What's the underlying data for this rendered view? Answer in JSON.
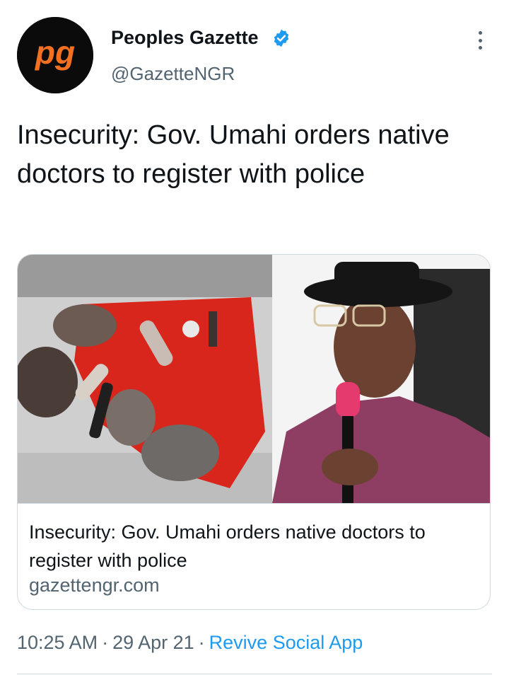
{
  "author": {
    "display_name": "Peoples Gazette",
    "handle": "@GazetteNGR",
    "avatar_logo_text": "pg",
    "verified_icon": "verified-badge-icon",
    "verified_color": "#1d9bf0"
  },
  "menu": {
    "icon": "more-options-icon"
  },
  "tweet": {
    "text": "Insecurity: Gov. Umahi orders native doctors to register with police"
  },
  "link_card": {
    "title": "Insecurity: Gov. Umahi orders native doctors to register with police",
    "domain": "gazettengr.com",
    "image_description": "confiscated-charms-and-governor-photo"
  },
  "meta": {
    "time": "10:25 AM",
    "separator": "·",
    "date": "29 Apr 21",
    "source": "Revive Social App"
  },
  "colors": {
    "text": "#0f1419",
    "secondary": "#536471",
    "accent": "#1d9bf0",
    "logo_orange": "#f37021"
  }
}
